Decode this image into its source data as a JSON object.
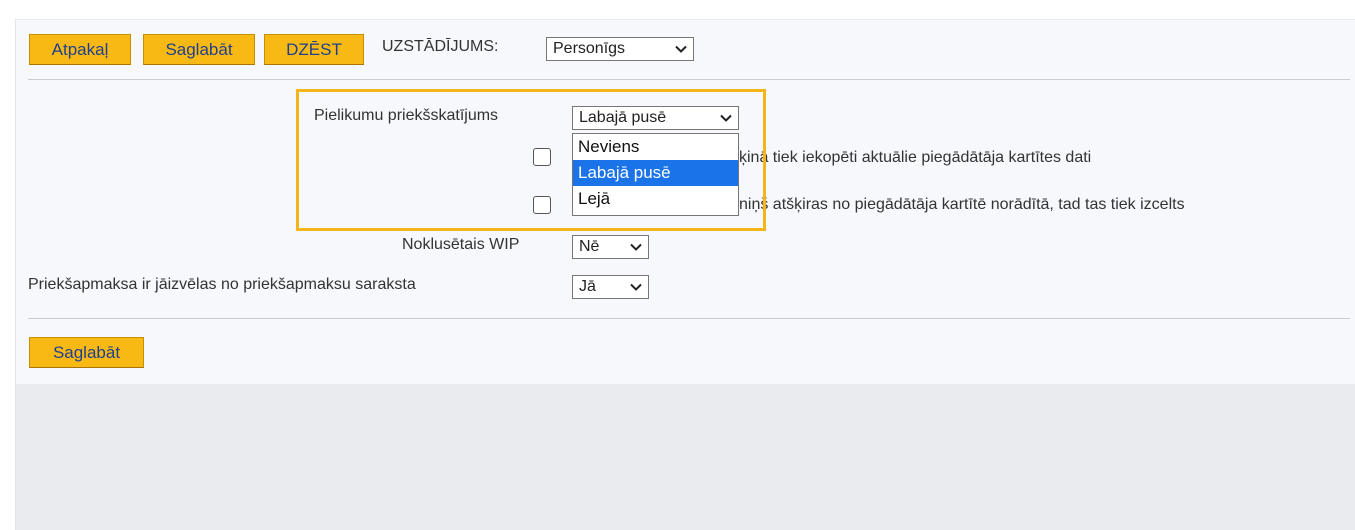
{
  "top_strip_text": "",
  "toolbar": {
    "back_label": "Atpakaļ",
    "save_label": "Saglabāt",
    "delete_label": "DZĒST",
    "setting_label": "UZSTĀDĪJUMS:",
    "setting_value": "Personīgs"
  },
  "settings": {
    "preview": {
      "label": "Pielikumu priekšskatījums",
      "value": "Labajā pusē",
      "options": [
        "Neviens",
        "Labajā pusē",
        "Lejā"
      ],
      "selected_index": 1
    },
    "checkbox1": {
      "label_visible": "ķinā tiek iekopēti aktuālie piegādātāja kartītes dati",
      "checked": false
    },
    "checkbox2": {
      "label_visible": "niņš atšķiras no piegādātāja kartītē norādītā, tad tas tiek izcelts",
      "checked": false
    },
    "wip": {
      "label": "Noklusētais WIP",
      "value": "Nē"
    },
    "prepayment": {
      "label": "Priekšapmaksa ir jāizvēlas no priekšapmaksu saraksta",
      "value": "Jā"
    }
  },
  "footer": {
    "save_label": "Saglabāt"
  },
  "colors": {
    "button_bg": "#f9b915",
    "button_text": "#1f3f8f",
    "highlight": "#f5b419",
    "selected_option": "#1a73e8"
  }
}
